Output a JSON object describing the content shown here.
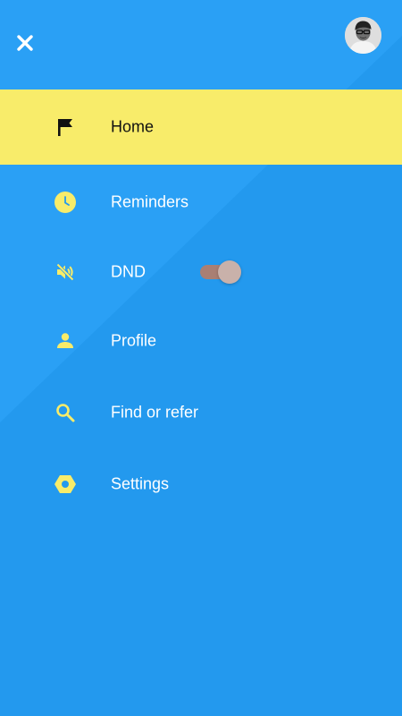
{
  "colors": {
    "background": "#2399ee",
    "background_light": "#2a9ff4",
    "active_item": "#f8ec6a",
    "icon_yellow": "#f8ec6a",
    "text_light": "#ffffff",
    "text_dark": "#111111",
    "toggle_track": "#a97f73",
    "toggle_thumb": "#c9b1aa"
  },
  "header": {
    "close_icon": "close-icon",
    "avatar_icon": "user-avatar"
  },
  "menu": {
    "items": [
      {
        "label": "Home",
        "icon": "flag-icon",
        "active": true
      },
      {
        "label": "Reminders",
        "icon": "clock-icon",
        "active": false
      },
      {
        "label": "DND",
        "icon": "volume-off-icon",
        "active": false,
        "toggle": "on"
      },
      {
        "label": "Profile",
        "icon": "person-icon",
        "active": false
      },
      {
        "label": "Find or refer",
        "icon": "search-icon",
        "active": false
      },
      {
        "label": "Settings",
        "icon": "settings-hex-icon",
        "active": false
      }
    ]
  }
}
